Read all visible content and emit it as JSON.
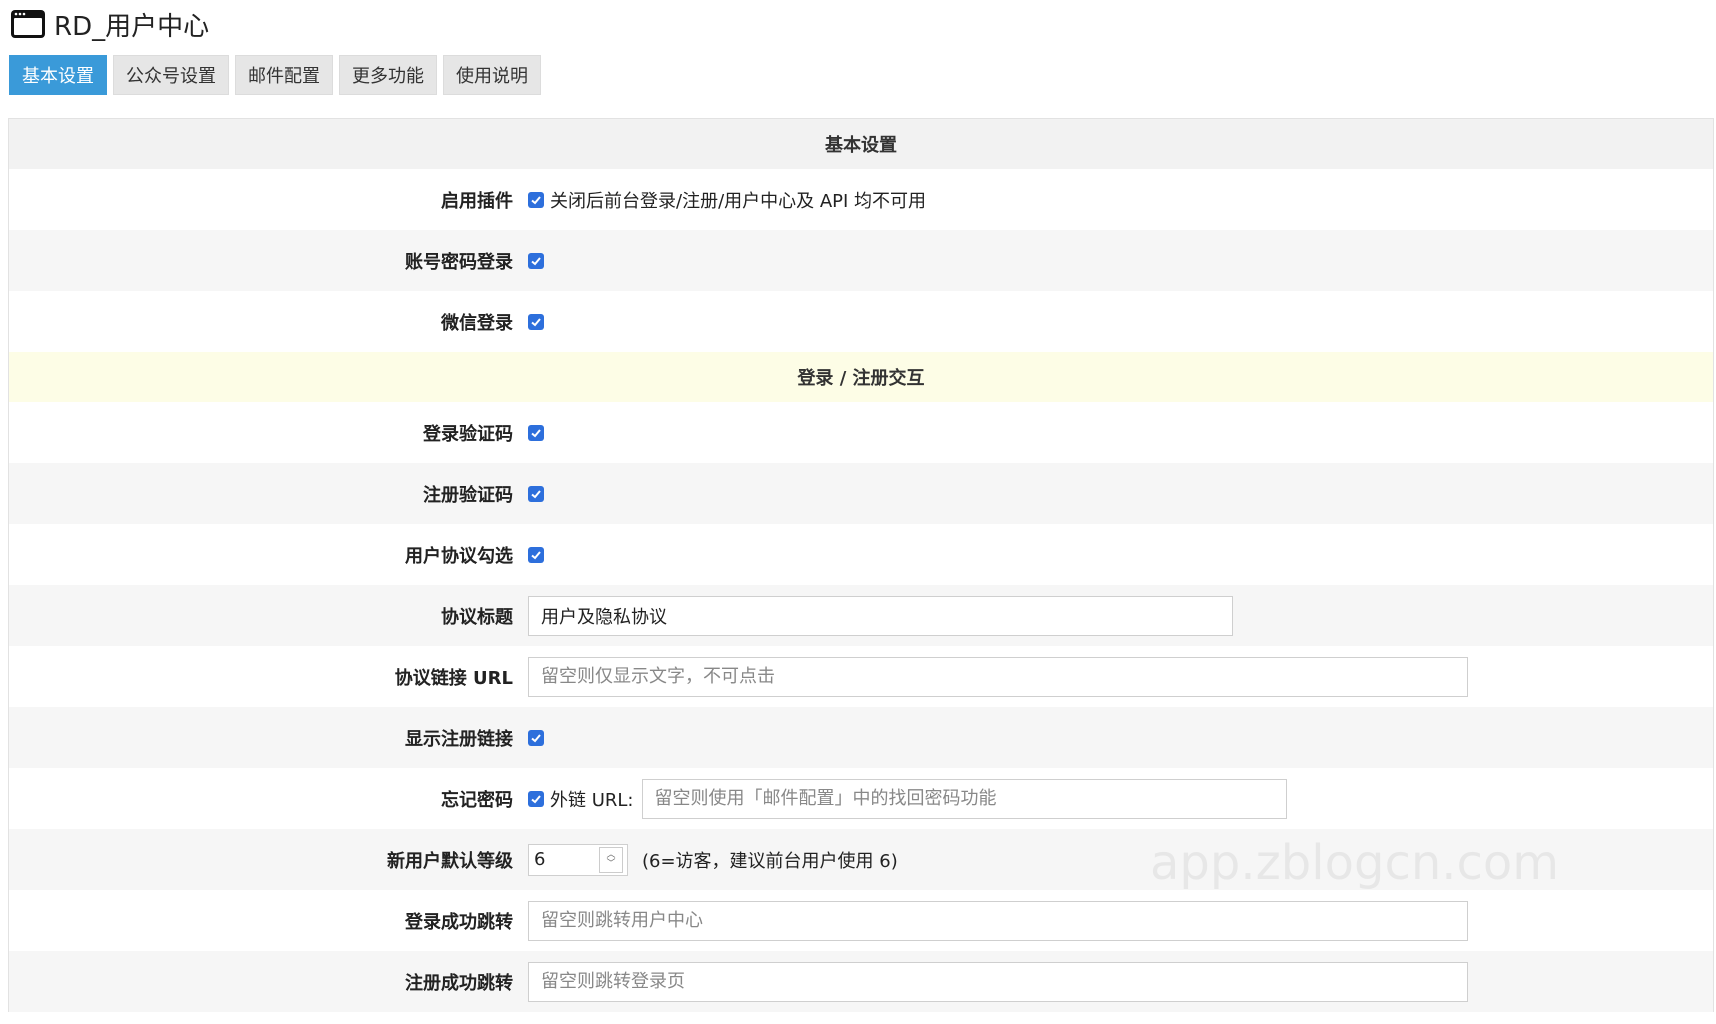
{
  "app": {
    "title": "RD_用户中心"
  },
  "tabs": [
    "基本设置",
    "公众号设置",
    "邮件配置",
    "更多功能",
    "使用说明"
  ],
  "sections": {
    "basic": "基本设置",
    "interaction": "登录 / 注册交互"
  },
  "rows": {
    "enable_plugin": {
      "label": "启用插件",
      "hint": "关闭后前台登录/注册/用户中心及 API 均不可用"
    },
    "password_login": {
      "label": "账号密码登录"
    },
    "wechat_login": {
      "label": "微信登录"
    },
    "login_captcha": {
      "label": "登录验证码"
    },
    "register_captcha": {
      "label": "注册验证码"
    },
    "agreement_check": {
      "label": "用户协议勾选"
    },
    "agreement_title": {
      "label": "协议标题",
      "value": "用户及隐私协议"
    },
    "agreement_url": {
      "label": "协议链接 URL",
      "placeholder": "留空则仅显示文字，不可点击"
    },
    "show_register_link": {
      "label": "显示注册链接"
    },
    "forgot_password": {
      "label": "忘记密码",
      "external_label": "外链 URL:",
      "placeholder": "留空则使用「邮件配置」中的找回密码功能"
    },
    "default_level": {
      "label": "新用户默认等级",
      "value": "6",
      "note": "(6=访客，建议前台用户使用 6)"
    },
    "login_redirect": {
      "label": "登录成功跳转",
      "placeholder": "留空则跳转用户中心"
    },
    "register_redirect": {
      "label": "注册成功跳转",
      "placeholder": "留空则跳转登录页"
    }
  },
  "watermark": "app.zblogcn.com",
  "colors": {
    "accent": "#3a9ad9",
    "checkbox": "#2d6fdc"
  }
}
